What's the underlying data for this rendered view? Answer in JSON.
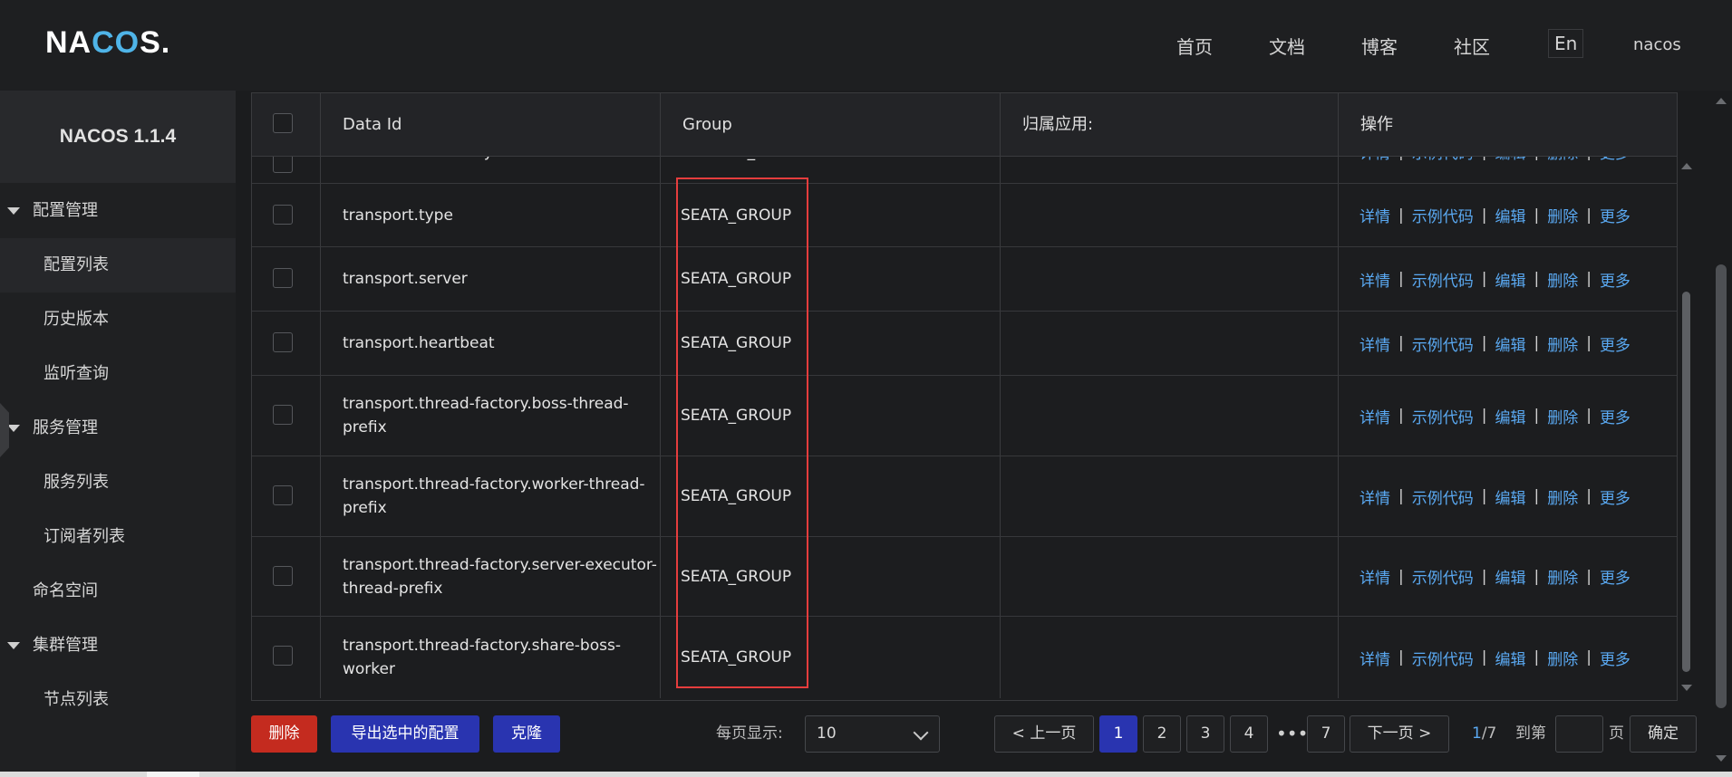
{
  "header": {
    "logo": {
      "before": "NA",
      "mid": "CO",
      "after": "S."
    },
    "nav": [
      {
        "label": "首页"
      },
      {
        "label": "文档"
      },
      {
        "label": "博客"
      },
      {
        "label": "社区"
      }
    ],
    "lang_label": "En",
    "username": "nacos"
  },
  "sidebar": {
    "title": "NACOS 1.1.4",
    "items": [
      {
        "label": "配置管理"
      },
      {
        "label": "配置列表"
      },
      {
        "label": "历史版本"
      },
      {
        "label": "监听查询"
      },
      {
        "label": "服务管理"
      },
      {
        "label": "服务列表"
      },
      {
        "label": "订阅者列表"
      },
      {
        "label": "命名空间"
      },
      {
        "label": "集群管理"
      },
      {
        "label": "节点列表"
      }
    ]
  },
  "table": {
    "columns": [
      "Data Id",
      "Group",
      "归属应用:",
      "操作"
    ],
    "partial_row": {
      "data_id": "service-order-test.yaml",
      "group": "DEFAULT_GROUP"
    },
    "rows": [
      {
        "data_id": "transport.type",
        "group": "SEATA_GROUP"
      },
      {
        "data_id": "transport.server",
        "group": "SEATA_GROUP"
      },
      {
        "data_id": "transport.heartbeat",
        "group": "SEATA_GROUP"
      },
      {
        "data_id": "transport.thread-factory.boss-thread-prefix",
        "group": "SEATA_GROUP"
      },
      {
        "data_id": "transport.thread-factory.worker-thread-prefix",
        "group": "SEATA_GROUP"
      },
      {
        "data_id": "transport.thread-factory.server-executor-thread-prefix",
        "group": "SEATA_GROUP"
      },
      {
        "data_id": "transport.thread-factory.share-boss-worker",
        "group": "SEATA_GROUP"
      }
    ],
    "actions": [
      "详情",
      "示例代码",
      "编辑",
      "删除",
      "更多"
    ],
    "action_separator": "|"
  },
  "footer": {
    "delete_label": "删除",
    "export_label": "导出选中的配置",
    "clone_label": "克隆",
    "page_size_label": "每页显示:",
    "page_size_value": "10",
    "prev_label": "上一页",
    "next_label": "下一页",
    "pages": [
      "1",
      "2",
      "3",
      "4",
      "7"
    ],
    "ellipsis": "•••",
    "current_page": "1",
    "total_pages": "/7",
    "goto_label": "到第",
    "page_unit": "页",
    "confirm_label": "确定"
  },
  "colors": {
    "accent": "#2934b0",
    "danger": "#c42b1f",
    "link": "#5aa9f2",
    "highlight_box": "#e53d3d"
  }
}
